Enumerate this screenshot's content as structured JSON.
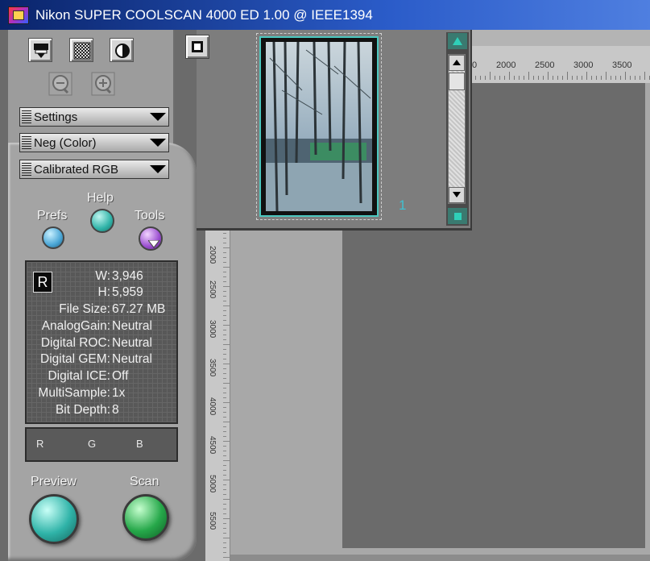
{
  "window": {
    "title": "Nikon SUPER COOLSCAN 4000 ED 1.00 @ IEEE1394"
  },
  "toolbar": {
    "icons": [
      "scanner-icon",
      "grain-pattern-icon",
      "contrast-icon",
      "zoom-out-icon",
      "zoom-in-icon"
    ]
  },
  "dropdowns": {
    "settings": "Settings",
    "film_type": "Neg (Color)",
    "color_space": "Calibrated RGB"
  },
  "buttons": {
    "help": "Help",
    "prefs": "Prefs",
    "tools": "Tools",
    "preview": "Preview",
    "scan": "Scan"
  },
  "info": {
    "badge": "R",
    "rows": [
      {
        "label": "W:",
        "value": "3,946"
      },
      {
        "label": "H:",
        "value": "5,959"
      },
      {
        "label": "File Size:",
        "value": "67.27 MB"
      },
      {
        "label": "AnalogGain:",
        "value": "Neutral"
      },
      {
        "label": "Digital ROC:",
        "value": "Neutral"
      },
      {
        "label": "Digital GEM:",
        "value": "Neutral"
      },
      {
        "label": "Digital ICE:",
        "value": "Off"
      },
      {
        "label": "MultiSample:",
        "value": "1x"
      },
      {
        "label": "Bit Depth:",
        "value": "8"
      }
    ]
  },
  "channels": {
    "r": "R",
    "g": "G",
    "b": "B"
  },
  "filmstrip": {
    "frame_number": "1"
  },
  "rulers": {
    "horizontal": [
      "0",
      "2000",
      "2500",
      "3000",
      "3500"
    ],
    "vertical": [
      "2000",
      "2500",
      "3000",
      "3500",
      "4000",
      "4500",
      "5000",
      "5500"
    ]
  },
  "colors": {
    "titlebar": "#0a246a",
    "preview_orb": "#2fb3a8",
    "scan_orb": "#26a84a",
    "tools_orb": "#9b4fd0",
    "prefs_orb": "#4aa6d6",
    "frame_border": "#4cc8c0"
  }
}
